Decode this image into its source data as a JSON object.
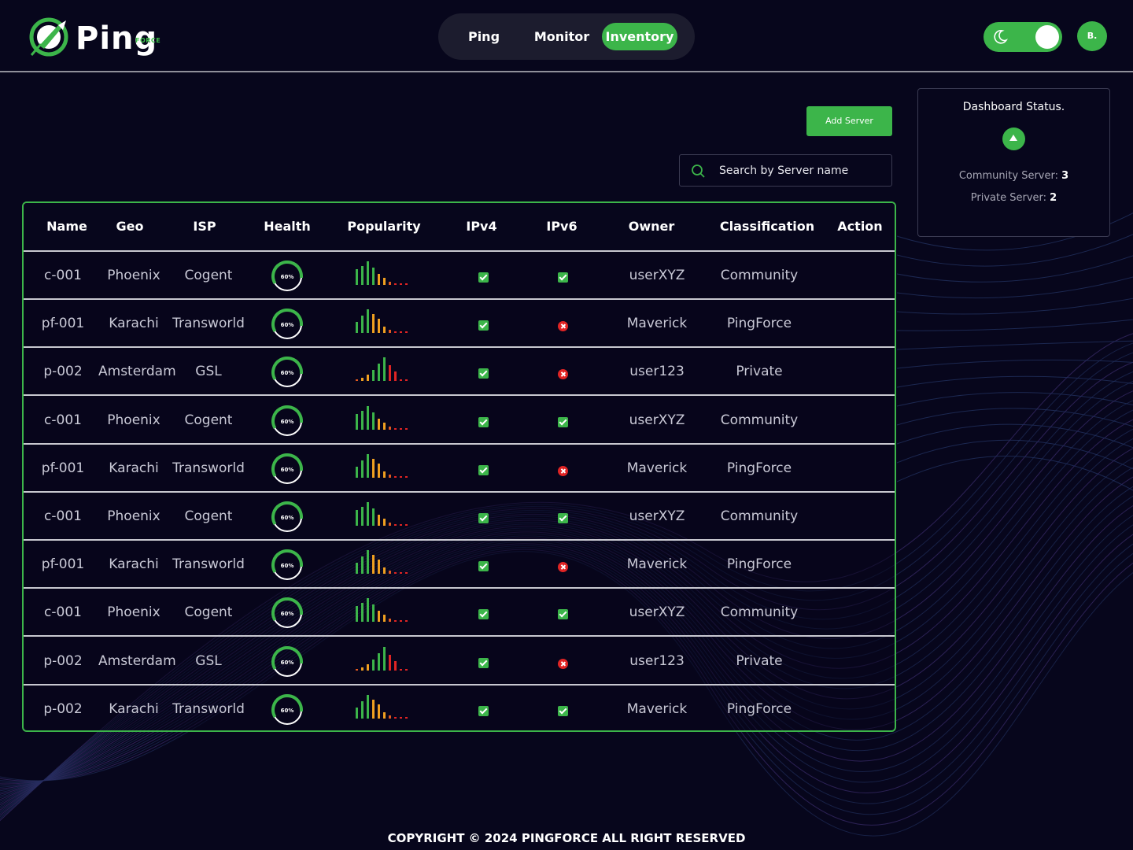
{
  "app": {
    "logo_text": "Ping",
    "logo_sub": "FORCE"
  },
  "nav": {
    "tabs": [
      {
        "label": "Ping",
        "active": false
      },
      {
        "label": "Monitor",
        "active": false
      },
      {
        "label": "Inventory",
        "active": true
      }
    ]
  },
  "header": {
    "theme_toggle": "dark",
    "avatar_initial": "B."
  },
  "toolbar": {
    "add_server_label": "Add Server",
    "search_placeholder": "Search by Server name"
  },
  "status_card": {
    "title": "Dashboard Status.",
    "community_label": "Community Server:",
    "community_count": "3",
    "private_label": "Private Server:",
    "private_count": "2"
  },
  "table": {
    "columns": [
      "Name",
      "Geo",
      "ISP",
      "Health",
      "Popularity",
      "IPv4",
      "IPv6",
      "Owner",
      "Classification",
      "Action"
    ],
    "rows": [
      {
        "name": "c-001",
        "geo": "Phoenix",
        "isp": "Cogent",
        "health": "60%",
        "popularity": "green",
        "ipv4": true,
        "ipv6": true,
        "owner": "userXYZ",
        "classification": "Community"
      },
      {
        "name": "pf-001",
        "geo": "Karachi",
        "isp": "Transworld",
        "health": "60%",
        "popularity": "orange",
        "ipv4": true,
        "ipv6": false,
        "owner": "Maverick",
        "classification": "PingForce"
      },
      {
        "name": "p-002",
        "geo": "Amsterdam",
        "isp": "GSL",
        "health": "60%",
        "popularity": "rising",
        "ipv4": true,
        "ipv6": false,
        "owner": "user123",
        "classification": "Private"
      },
      {
        "name": "c-001",
        "geo": "Phoenix",
        "isp": "Cogent",
        "health": "60%",
        "popularity": "green",
        "ipv4": true,
        "ipv6": true,
        "owner": "userXYZ",
        "classification": "Community"
      },
      {
        "name": "pf-001",
        "geo": "Karachi",
        "isp": "Transworld",
        "health": "60%",
        "popularity": "orange",
        "ipv4": true,
        "ipv6": false,
        "owner": "Maverick",
        "classification": "PingForce"
      },
      {
        "name": "c-001",
        "geo": "Phoenix",
        "isp": "Cogent",
        "health": "60%",
        "popularity": "green",
        "ipv4": true,
        "ipv6": true,
        "owner": "userXYZ",
        "classification": "Community"
      },
      {
        "name": "pf-001",
        "geo": "Karachi",
        "isp": "Transworld",
        "health": "60%",
        "popularity": "orange",
        "ipv4": true,
        "ipv6": false,
        "owner": "Maverick",
        "classification": "PingForce"
      },
      {
        "name": "c-001",
        "geo": "Phoenix",
        "isp": "Cogent",
        "health": "60%",
        "popularity": "green",
        "ipv4": true,
        "ipv6": true,
        "owner": "userXYZ",
        "classification": "Community"
      },
      {
        "name": "p-002",
        "geo": "Amsterdam",
        "isp": "GSL",
        "health": "60%",
        "popularity": "rising",
        "ipv4": true,
        "ipv6": false,
        "owner": "user123",
        "classification": "Private"
      },
      {
        "name": "p-002",
        "geo": "Karachi",
        "isp": "Transworld",
        "health": "60%",
        "popularity": "orange",
        "ipv4": true,
        "ipv6": true,
        "owner": "Maverick",
        "classification": "PingForce"
      }
    ]
  },
  "footer": {
    "copyright": "COPYRIGHT © 2024 PINGFORCE ALL RIGHT RESERVED"
  },
  "colors": {
    "accent": "#3cb54a",
    "background": "#07061c",
    "error": "#e02424"
  }
}
